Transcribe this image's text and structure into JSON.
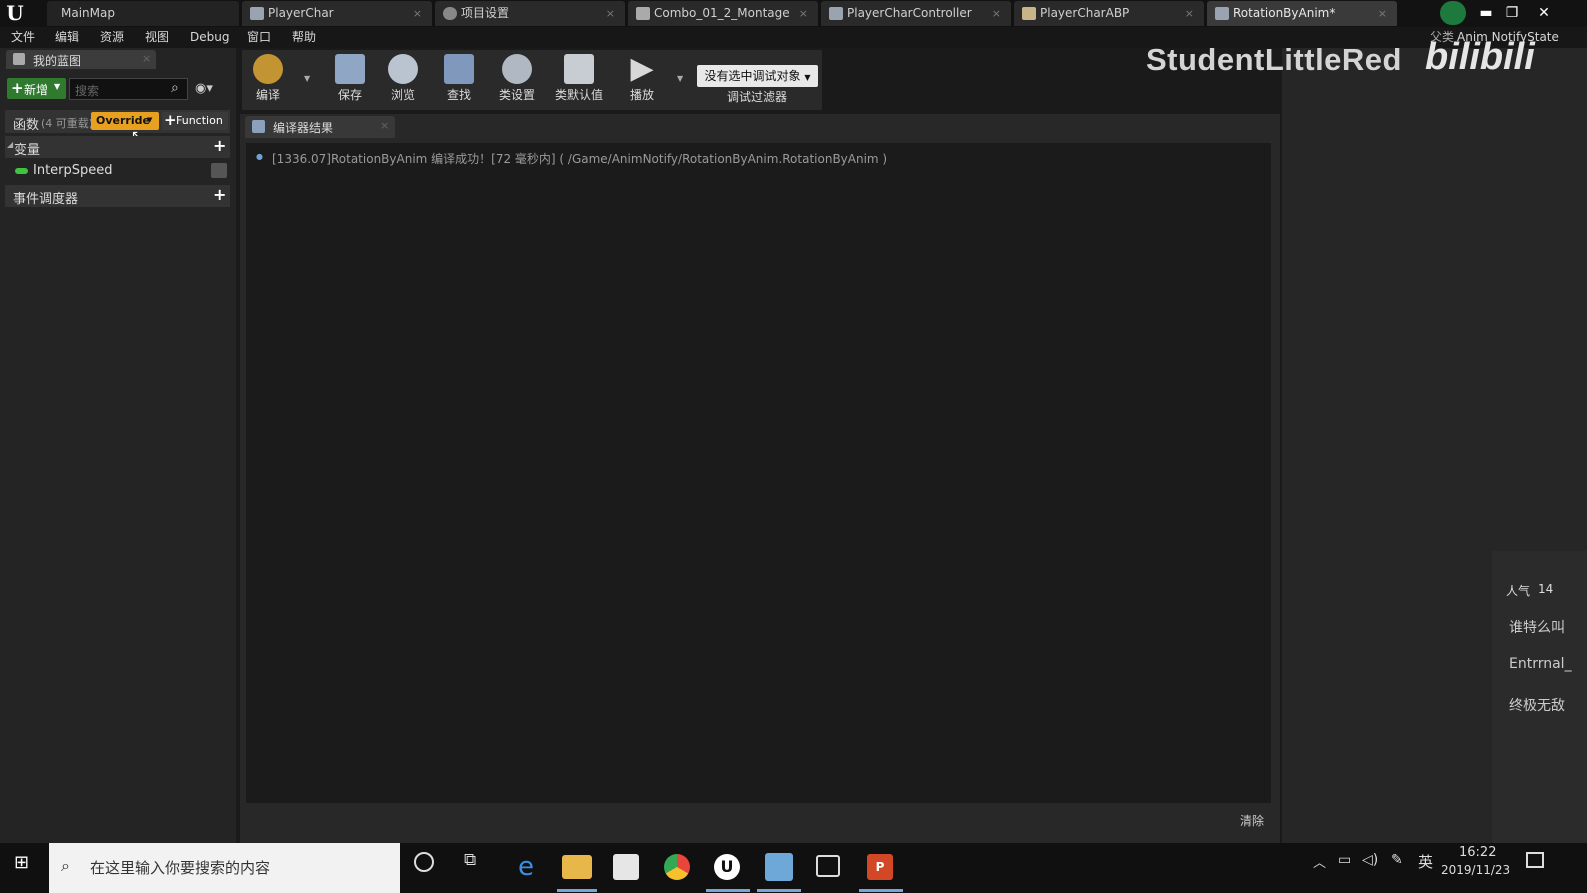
{
  "titlebar": {
    "tabs": [
      {
        "label": "MainMap"
      },
      {
        "label": "PlayerChar"
      },
      {
        "label": "项目设置"
      },
      {
        "label": "Combo_01_2_Montage"
      },
      {
        "label": "PlayerCharController"
      },
      {
        "label": "PlayerCharABP"
      },
      {
        "label": "RotationByAnim*"
      }
    ],
    "parent_class": "Anim NotifyState",
    "parent_prefix": "父类"
  },
  "menu": [
    "文件",
    "编辑",
    "资源",
    "视图",
    "Debug",
    "窗口",
    "帮助"
  ],
  "left_panel": {
    "tab_label": "我的蓝图",
    "add_new_label": "新增",
    "search_placeholder": "搜索",
    "functions": {
      "label": "函数",
      "note": "(4 可重载)",
      "override_label": "Override",
      "function_button_label": "Function"
    },
    "variables": {
      "label": "变量",
      "items": [
        "InterpSpeed"
      ]
    },
    "event_dispatchers": {
      "label": "事件调度器"
    }
  },
  "toolbar": {
    "items": [
      "编译",
      "保存",
      "浏览",
      "查找",
      "类设置",
      "类默认值",
      "播放"
    ],
    "debug_select": "没有选中调试对象",
    "debug_filter": "调试过滤器"
  },
  "compiler_results": {
    "tab_label": "编译器结果",
    "log": "[1336.07]RotationByAnim 编译成功！[72 毫秒内]  ( /Game/AnimNotify/RotationByAnim.RotationByAnim )",
    "clear_label": "清除"
  },
  "overlay": {
    "watermark": "StudentLittleRed",
    "bili_logo": "bilibili",
    "popularity_label": "人气",
    "popularity_value": "14",
    "chat": [
      "谁特么叫",
      "Entrrnal_",
      "终极无敌"
    ]
  },
  "taskbar": {
    "search_placeholder": "在这里输入你要搜索的内容",
    "tray_lang": "英",
    "time": "16:22",
    "date": "2019/11/23"
  },
  "colors": {
    "accent_green": "#2f7a2f",
    "override_orange": "#e8a020",
    "variable_green": "#3fc43f"
  }
}
